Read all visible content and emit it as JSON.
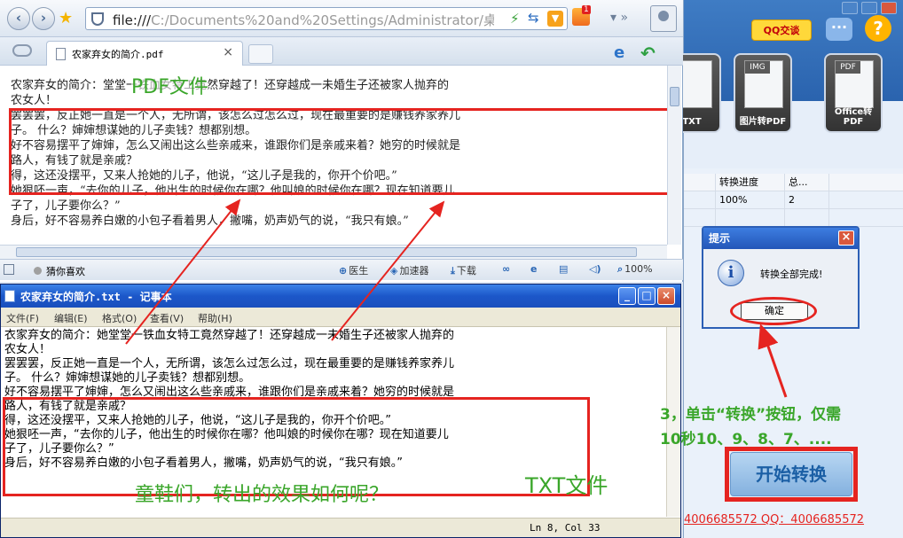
{
  "browser": {
    "address": "file:///C:/Documents%20and%20Settings/Administrator/桌面/新建",
    "address_prefix": "file:///",
    "address_rest": "C:/Documents%20and%20Settings/Administrator/桌面/新建",
    "app_badge": "1",
    "tab_title": "农家弃女的简介.pdf",
    "status": {
      "guess": "猜你喜欢",
      "doctor": "医生",
      "accelerator": "加速器",
      "download": "下载",
      "zoom": "100%"
    },
    "pdf_lines": [
      "农家弃女的简介：堂堂一铁血女特工竟然穿越了！还穿越成一未婚生子还被家人抛弃的",
      "农女人！",
      "罢罢罢，反正她一直是一个人，无所谓，该怎么过怎么过，现在最重要的是赚钱养家养儿",
      "子。 什么？婶婶想谋她的儿子卖钱？想都别想。",
      "好不容易摆平了婶婶，怎么又闹出这么些亲戚来，谁跟你们是亲戚来着？她穷的时候就是",
      "路人，有钱了就是亲戚？",
      "得，这还没摆平，又来人抢她的儿子，他说，“这儿子是我的，你开个价吧。”",
      "她狠呸一声，“去你的儿子，他出生的时候你在哪？他叫娘的时候你在哪？现在知道要儿",
      "子了，儿子要你么？”",
      "身后，好不容易养白嫩的小包子看着男人，撇嘴，奶声奶气的说，“我只有娘。”"
    ],
    "pdf_label": "PDF文件"
  },
  "notepad": {
    "title": "农家弃女的简介.txt - 记事本",
    "menu": [
      "文件(F)",
      "编辑(E)",
      "格式(O)",
      "查看(V)",
      "帮助(H)"
    ],
    "lines": [
      "衣家弃女的简介：她堂堂一铁血女特工竟然穿越了！还穿越成一未婚生子还被家人抛弃的",
      "农女人！",
      "罢罢罢，反正她一直是一个人，无所谓，该怎么过怎么过，现在最重要的是赚钱养家养儿",
      "子。 什么？婶婶想谋她的儿子卖钱？想都别想。",
      "好不容易摆平了婶婶，怎么又闹出这么些亲戚来，谁跟你们是亲戚来着？她穷的时候就是",
      "路人，有钱了就是亲戚？",
      "得，这还没摆平，又来人抢她的儿子，他说，“这儿子是我的，你开个价吧。”",
      "她狠呸一声，“去你的儿子，他出生的时候你在哪？他叫娘的时候你在哪？现在知道要儿",
      "子了，儿子要你么？”",
      "身后，好不容易养白嫩的小包子看着男人，撇嘴，奶声奶气的说，“我只有娘。”"
    ],
    "status_pos": "Ln 8, Col 33",
    "txt_label": "TXT文件",
    "question": "童鞋们，转出的效果如何呢？"
  },
  "converter": {
    "qq_label": "QQ交谈",
    "tiles": [
      {
        "tag": "",
        "label": "TXT"
      },
      {
        "tag": "IMG",
        "label": "图片转PDF"
      },
      {
        "tag": "PDF",
        "label": "Office转PDF"
      }
    ],
    "table_headers": [
      "转换进度",
      "总..."
    ],
    "table_row": [
      "100%",
      "2"
    ],
    "dialog": {
      "title": "提示",
      "message": "转换全部完成!",
      "ok": "确定"
    },
    "start_button": "开始转换",
    "contact": "4006685572 QQ：4006685572"
  },
  "annotation": {
    "step_line1": "3，单击“转换”按钮，仅需",
    "step_line2": "10秒10、9、8、7、...."
  },
  "colors": {
    "annotation_red": "#e52420",
    "annotation_green": "#3aa62a",
    "title_blue": "#1c57c9"
  }
}
